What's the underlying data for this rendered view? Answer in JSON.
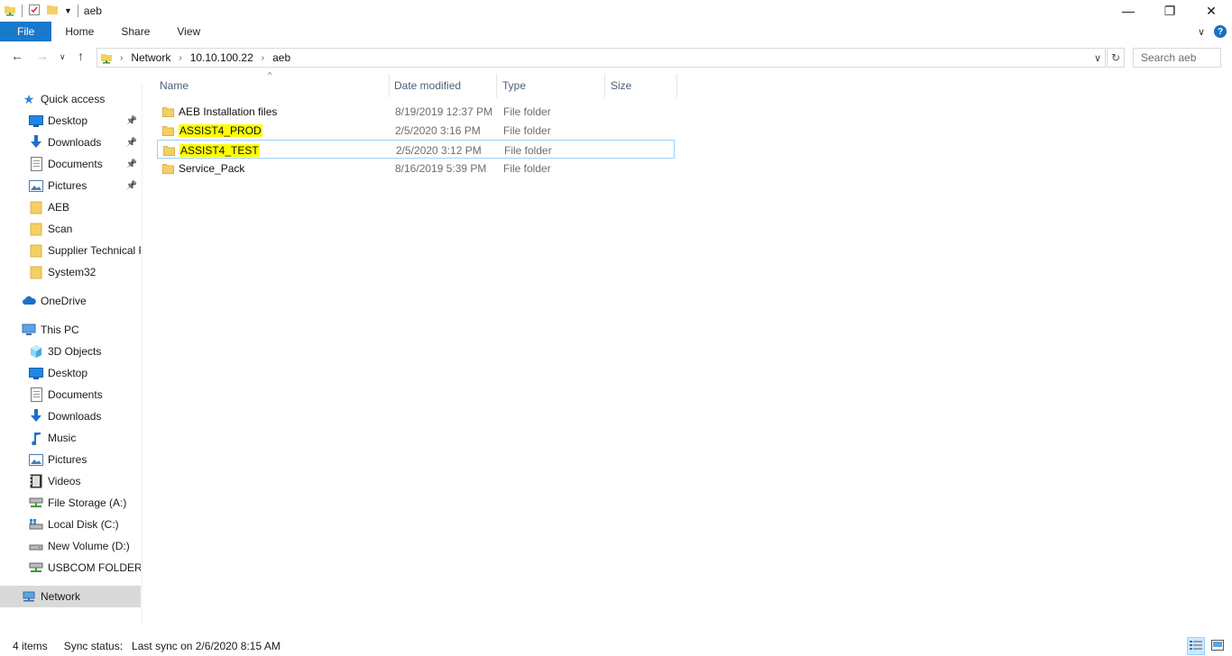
{
  "window": {
    "title": "aeb",
    "controls": {
      "minimize": "—",
      "maximize": "❐",
      "close": "✕"
    }
  },
  "ribbon": {
    "tabs": [
      "File",
      "Home",
      "Share",
      "View"
    ],
    "expand_glyph": "∨",
    "help_glyph": "?"
  },
  "address": {
    "breadcrumbs": [
      "Network",
      "10.10.100.22",
      "aeb"
    ],
    "search_placeholder": "Search aeb"
  },
  "nav": {
    "quick_access": "Quick access",
    "quick_items": [
      {
        "label": "Desktop",
        "icon": "desktop-icon",
        "pinned": true
      },
      {
        "label": "Downloads",
        "icon": "downloads-icon",
        "pinned": true
      },
      {
        "label": "Documents",
        "icon": "documents-icon",
        "pinned": true
      },
      {
        "label": "Pictures",
        "icon": "pictures-icon",
        "pinned": true
      },
      {
        "label": "AEB",
        "icon": "folder-icon",
        "pinned": false
      },
      {
        "label": "Scan",
        "icon": "folder-icon",
        "pinned": false
      },
      {
        "label": "Supplier Technical F",
        "icon": "folder-icon",
        "pinned": false
      },
      {
        "label": "System32",
        "icon": "folder-icon",
        "pinned": false
      }
    ],
    "onedrive": "OneDrive",
    "this_pc": "This PC",
    "pc_items": [
      {
        "label": "3D Objects",
        "icon": "3d-objects-icon"
      },
      {
        "label": "Desktop",
        "icon": "desktop-icon"
      },
      {
        "label": "Documents",
        "icon": "documents-icon"
      },
      {
        "label": "Downloads",
        "icon": "downloads-icon"
      },
      {
        "label": "Music",
        "icon": "music-icon"
      },
      {
        "label": "Pictures",
        "icon": "pictures-icon"
      },
      {
        "label": "Videos",
        "icon": "videos-icon"
      },
      {
        "label": "File Storage (A:)",
        "icon": "network-drive-icon"
      },
      {
        "label": "Local Disk (C:)",
        "icon": "local-disk-icon"
      },
      {
        "label": "New Volume (D:)",
        "icon": "drive-icon"
      },
      {
        "label": "USBCOM FOLDER (\\",
        "icon": "network-drive-icon"
      }
    ],
    "network": "Network"
  },
  "columns": {
    "name": "Name",
    "date": "Date modified",
    "type": "Type",
    "size": "Size"
  },
  "files": [
    {
      "name": "AEB Installation files",
      "date": "8/19/2019 12:37 PM",
      "type": "File folder",
      "highlighted": false
    },
    {
      "name": "ASSIST4_PROD",
      "date": "2/5/2020 3:16 PM",
      "type": "File folder",
      "highlighted": true
    },
    {
      "name": "ASSIST4_TEST",
      "date": "2/5/2020 3:12 PM",
      "type": "File folder",
      "highlighted": true
    },
    {
      "name": "Service_Pack",
      "date": "8/16/2019 5:39 PM",
      "type": "File folder",
      "highlighted": false
    }
  ],
  "status": {
    "count": "4 items",
    "sync": "Sync status:   Last sync on 2/6/2020 8:15 AM"
  },
  "colors": {
    "accent": "#1979ca",
    "highlight": "#ffff00",
    "folder": "#f4cf63",
    "selection": "#d9d9d9"
  }
}
